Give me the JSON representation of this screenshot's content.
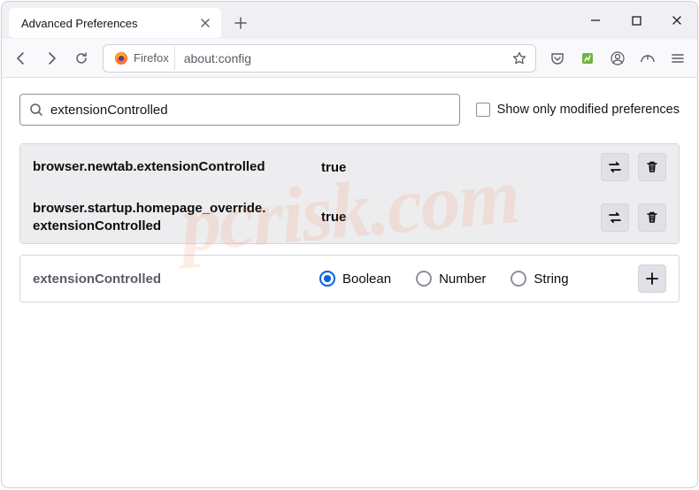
{
  "tab": {
    "title": "Advanced Preferences"
  },
  "urlbar": {
    "identity": "Firefox",
    "url": "about:config"
  },
  "search": {
    "value": "extensionControlled"
  },
  "checkbox": {
    "label": "Show only modified preferences"
  },
  "results": [
    {
      "name": "browser.newtab.extensionControlled",
      "value": "true"
    },
    {
      "name": "browser.startup.homepage_override. extensionControlled",
      "value": "true"
    }
  ],
  "newpref": {
    "name": "extensionControlled",
    "types": {
      "boolean": "Boolean",
      "number": "Number",
      "string": "String"
    },
    "selected": "boolean"
  },
  "watermark": "pcrisk.com"
}
